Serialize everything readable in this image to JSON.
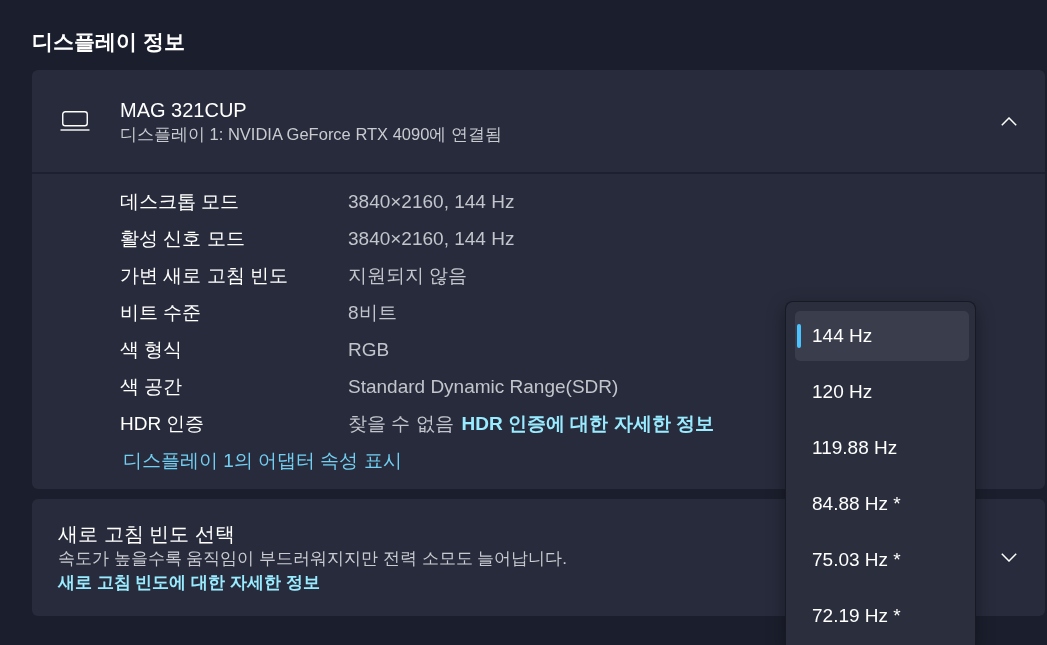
{
  "section_title": "디스플레이 정보",
  "display_card": {
    "name": "MAG 321CUP",
    "subtitle": "디스플레이 1: NVIDIA GeForce RTX 4090에 연결됨",
    "expanded": true,
    "properties": [
      {
        "label": "데스크톱 모드",
        "value": "3840×2160, 144 Hz"
      },
      {
        "label": "활성 신호 모드",
        "value": "3840×2160, 144 Hz"
      },
      {
        "label": "가변 새로 고침 빈도",
        "value": "지원되지 않음"
      },
      {
        "label": "비트 수준",
        "value": "8비트"
      },
      {
        "label": "색 형식",
        "value": "RGB"
      },
      {
        "label": "색 공간",
        "value": "Standard Dynamic Range(SDR)"
      },
      {
        "label": "HDR 인증",
        "value": "찾을 수 없음",
        "link": "HDR 인증에 대한 자세한 정보"
      }
    ],
    "adapter_link": "디스플레이 1의 어댑터 속성 표시"
  },
  "refresh_rate_card": {
    "title": "새로 고침 빈도 선택",
    "description": "속도가 높을수록 움직임이 부드러워지지만 전력 소모도 늘어납니다.",
    "link": "새로 고침 빈도에 대한 자세한 정보",
    "expanded": false,
    "dropdown": {
      "open": true,
      "options": [
        {
          "label": "144 Hz",
          "selected": true
        },
        {
          "label": "120 Hz",
          "selected": false
        },
        {
          "label": "119.88 Hz",
          "selected": false
        },
        {
          "label": "84.88 Hz *",
          "selected": false
        },
        {
          "label": "75.03 Hz *",
          "selected": false
        },
        {
          "label": "72.19 Hz *",
          "selected": false
        }
      ]
    }
  }
}
